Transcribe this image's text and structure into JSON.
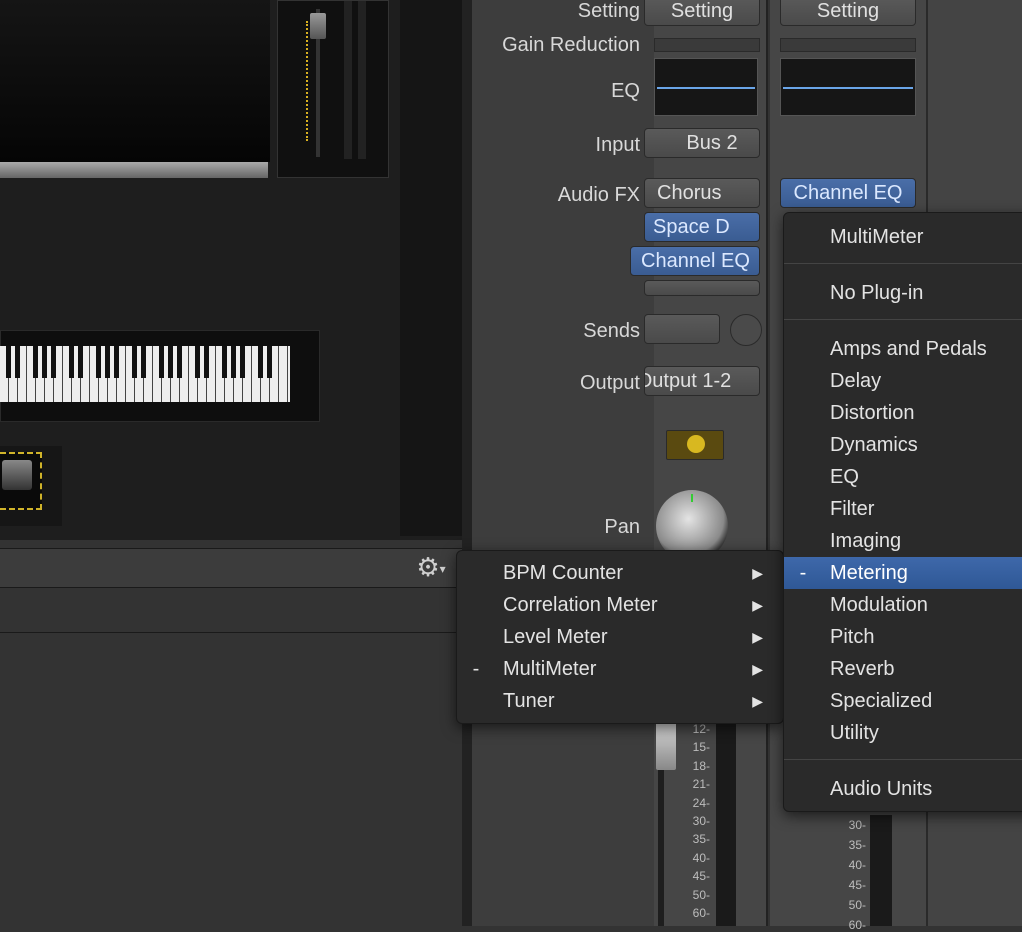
{
  "instrument": {
    "toolbar": {
      "gear_icon": "gear-icon"
    }
  },
  "labels": {
    "setting": "Setting",
    "gain_reduction": "Gain Reduction",
    "eq": "EQ",
    "input": "Input",
    "audio_fx": "Audio FX",
    "sends": "Sends",
    "output": "Output",
    "pan": "Pan"
  },
  "strip1": {
    "setting": "Setting",
    "input": "Bus 2",
    "fx": [
      "Chorus",
      "Space D",
      "Channel EQ"
    ],
    "output": "Output 1-2",
    "meter_scale": [
      "12",
      "15",
      "18",
      "21",
      "24",
      "30",
      "35",
      "40",
      "45",
      "50",
      "60"
    ]
  },
  "strip2": {
    "setting": "Setting",
    "fx": [
      "Channel EQ"
    ],
    "meter_scale": [
      "30",
      "35",
      "40",
      "45",
      "50",
      "60"
    ]
  },
  "submenu": {
    "items": [
      {
        "label": "BPM Counter",
        "mark": ""
      },
      {
        "label": "Correlation Meter",
        "mark": ""
      },
      {
        "label": "Level Meter",
        "mark": ""
      },
      {
        "label": "MultiMeter",
        "mark": "-"
      },
      {
        "label": "Tuner",
        "mark": ""
      }
    ]
  },
  "plugin_menu": {
    "recent": "MultiMeter",
    "no_plugin": "No Plug-in",
    "categories": [
      {
        "label": "Amps and Pedals",
        "mark": ""
      },
      {
        "label": "Delay",
        "mark": ""
      },
      {
        "label": "Distortion",
        "mark": ""
      },
      {
        "label": "Dynamics",
        "mark": ""
      },
      {
        "label": "EQ",
        "mark": ""
      },
      {
        "label": "Filter",
        "mark": ""
      },
      {
        "label": "Imaging",
        "mark": ""
      },
      {
        "label": "Metering",
        "mark": "-"
      },
      {
        "label": "Modulation",
        "mark": ""
      },
      {
        "label": "Pitch",
        "mark": ""
      },
      {
        "label": "Reverb",
        "mark": ""
      },
      {
        "label": "Specialized",
        "mark": ""
      },
      {
        "label": "Utility",
        "mark": ""
      }
    ],
    "audio_units": "Audio Units",
    "selected": "Metering"
  },
  "colors": {
    "selection": "#3e68aa",
    "plugin_blue": "#4a6ea8",
    "accent_yellow": "#d0b42a"
  }
}
